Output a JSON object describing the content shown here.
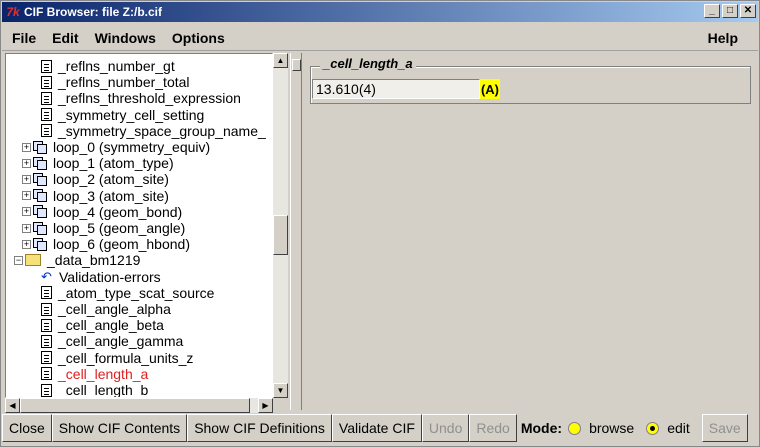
{
  "window": {
    "title": "CIF Browser: file Z:/b.cif",
    "app_icon": "tk-feather-icon",
    "controls": [
      "_",
      "□",
      "✕"
    ]
  },
  "menubar": {
    "items": [
      "File",
      "Edit",
      "Windows",
      "Options"
    ],
    "help": "Help"
  },
  "tree": {
    "items": [
      {
        "label": "_reflns_number_gt",
        "kind": "doc",
        "level": 2
      },
      {
        "label": "_reflns_number_total",
        "kind": "doc",
        "level": 2
      },
      {
        "label": "_reflns_threshold_expression",
        "kind": "doc",
        "level": 2
      },
      {
        "label": "_symmetry_cell_setting",
        "kind": "doc",
        "level": 2
      },
      {
        "label": "_symmetry_space_group_name_",
        "kind": "doc",
        "level": 2
      },
      {
        "label": "loop_0 (symmetry_equiv)",
        "kind": "loop",
        "level": 1
      },
      {
        "label": "loop_1 (atom_type)",
        "kind": "loop",
        "level": 1
      },
      {
        "label": "loop_2 (atom_site)",
        "kind": "loop",
        "level": 1
      },
      {
        "label": "loop_3 (atom_site)",
        "kind": "loop",
        "level": 1
      },
      {
        "label": "loop_4 (geom_bond)",
        "kind": "loop",
        "level": 1
      },
      {
        "label": "loop_5 (geom_angle)",
        "kind": "loop",
        "level": 1
      },
      {
        "label": "loop_6 (geom_hbond)",
        "kind": "loop",
        "level": 1
      },
      {
        "label": "_data_bm1219",
        "kind": "folder",
        "level": 0
      },
      {
        "label": "Validation-errors",
        "kind": "arrow",
        "level": 2
      },
      {
        "label": "_atom_type_scat_source",
        "kind": "doc",
        "level": 2
      },
      {
        "label": "_cell_angle_alpha",
        "kind": "doc",
        "level": 2
      },
      {
        "label": "_cell_angle_beta",
        "kind": "doc",
        "level": 2
      },
      {
        "label": "_cell_angle_gamma",
        "kind": "doc",
        "level": 2
      },
      {
        "label": "_cell_formula_units_z",
        "kind": "doc",
        "level": 2
      },
      {
        "label": "_cell_length_a",
        "kind": "doc",
        "level": 2,
        "selected": true
      },
      {
        "label": "_cell_length_b",
        "kind": "doc",
        "level": 2
      }
    ],
    "scroll_position": 0.45
  },
  "detail": {
    "legend": "_cell_length_a",
    "value": "13.610(4)",
    "unit": "(A)"
  },
  "buttons": {
    "close": "Close",
    "show_contents": "Show CIF Contents",
    "show_definitions": "Show CIF Definitions",
    "validate": "Validate CIF",
    "undo": "Undo",
    "redo": "Redo",
    "save": "Save"
  },
  "mode": {
    "label": "Mode:",
    "options": [
      "browse",
      "edit"
    ],
    "selected": "edit"
  },
  "colors": {
    "selected_text": "#e02020",
    "radio_fill": "#ffff00",
    "unit_badge": "#ffff00"
  }
}
